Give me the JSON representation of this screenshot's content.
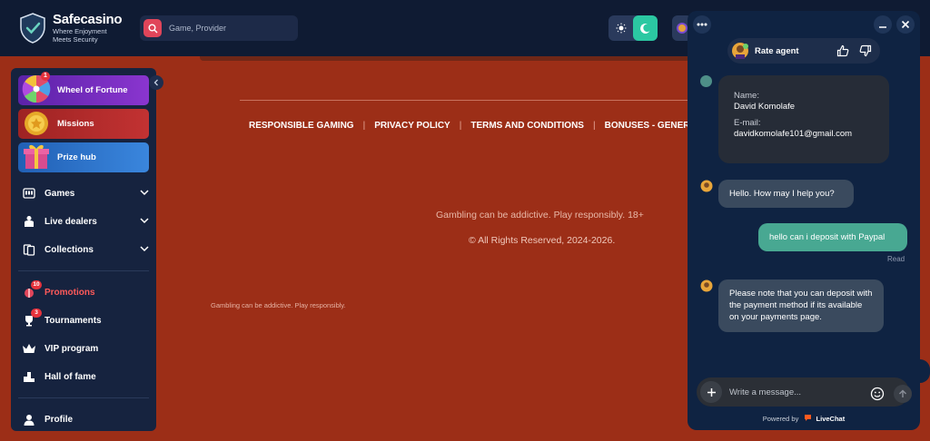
{
  "header": {
    "logo_name": "Safecasino",
    "logo_tagline_1": "Where Enjoyment",
    "logo_tagline_2": "Meets Security",
    "search_placeholder": "Game, Provider"
  },
  "sidebar": {
    "promo_cards": [
      {
        "label": "Wheel of Fortune",
        "badge": "1",
        "color": "#7a2fc4"
      },
      {
        "label": "Missions",
        "color": "#b52a2a"
      },
      {
        "label": "Prize hub",
        "color": "#2b6fc7"
      }
    ],
    "menu": [
      {
        "label": "Games",
        "icon": "slot-machine-icon"
      },
      {
        "label": "Live dealers",
        "icon": "dealer-icon"
      },
      {
        "label": "Collections",
        "icon": "cards-icon"
      }
    ],
    "secondary": [
      {
        "label": "Promotions",
        "icon": "gift-icon",
        "badge": "10"
      },
      {
        "label": "Tournaments",
        "icon": "trophy-icon",
        "badge": "3"
      },
      {
        "label": "VIP program",
        "icon": "crown-icon"
      },
      {
        "label": "Hall of fame",
        "icon": "podium-icon"
      }
    ],
    "profile_label": "Profile"
  },
  "footer": {
    "links": [
      "RESPONSIBLE GAMING",
      "PRIVACY POLICY",
      "TERMS AND CONDITIONS",
      "BONUSES - GENERAL TE"
    ],
    "disclaimer": "Gambling can be addictive. Play responsibly. 18+",
    "copyright": "© All Rights Reserved, 2024-2026.",
    "small_disclaimer": "Gambling can be addictive. Play responsibly."
  },
  "chat": {
    "rate_label": "Rate agent",
    "info": {
      "name_label": "Name:",
      "name_value": "David Komolafe",
      "email_label": "E-mail:",
      "email_value": "davidkomolafe101@gmail.com"
    },
    "messages": [
      {
        "from": "agent",
        "text": "Hello. How may I help you?"
      },
      {
        "from": "user",
        "text": "hello can i deposit with Paypal"
      },
      {
        "from": "agent",
        "text": "Please note that you can deposit with the payment method if its available on your payments page."
      }
    ],
    "read_status": "Read",
    "composer_placeholder": "Write a message...",
    "powered_by": "Powered by",
    "powered_brand": "LiveChat"
  },
  "colors": {
    "page_bg": "#9c2e17",
    "header_bg": "#0f1b33",
    "accent_green": "#2bc8a2",
    "promo_red": "#ff5a5a"
  }
}
